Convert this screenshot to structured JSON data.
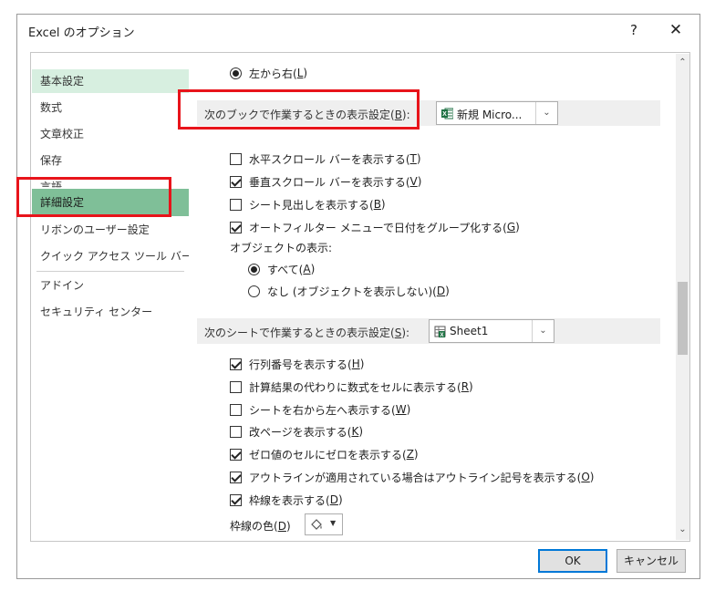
{
  "window": {
    "title": "Excel のオプション",
    "help": "?",
    "close": "✕"
  },
  "nav": {
    "items": [
      {
        "label": "基本設定"
      },
      {
        "label": "数式"
      },
      {
        "label": "文章校正"
      },
      {
        "label": "保存"
      },
      {
        "label": "言語"
      },
      {
        "label": "詳細設定"
      },
      {
        "label": "リボンのユーザー設定"
      },
      {
        "label": "クイック アクセス ツール バー"
      },
      {
        "label": "アドイン"
      },
      {
        "label": "セキュリティ センター"
      }
    ]
  },
  "content": {
    "top_radio": {
      "label": "左から右(",
      "key": "L",
      "end": ")"
    },
    "book_section": {
      "label": "次のブックで作業するときの表示設定(",
      "key": "B",
      "end": "):",
      "dropdown_value": "新規 Micro...",
      "options": [
        {
          "label": "水平スクロール バーを表示する(",
          "key": "T",
          "end": ")",
          "checked": false
        },
        {
          "label": "垂直スクロール バーを表示する(",
          "key": "V",
          "end": ")",
          "checked": true
        },
        {
          "label": "シート見出しを表示する(",
          "key": "B",
          "end": ")",
          "checked": false
        },
        {
          "label": "オートフィルター メニューで日付をグループ化する(",
          "key": "G",
          "end": ")",
          "checked": true
        }
      ],
      "objects_label": "オブジェクトの表示:",
      "objects_radios": [
        {
          "label": "すべて(",
          "key": "A",
          "end": ")",
          "checked": true
        },
        {
          "label": "なし (オブジェクトを表示しない)(",
          "key": "D",
          "end": ")",
          "checked": false
        }
      ]
    },
    "sheet_section": {
      "label": "次のシートで作業するときの表示設定(",
      "key": "S",
      "end": "):",
      "dropdown_value": "Sheet1",
      "options": [
        {
          "label": "行列番号を表示する(",
          "key": "H",
          "end": ")",
          "checked": true
        },
        {
          "label": "計算結果の代わりに数式をセルに表示する(",
          "key": "R",
          "end": ")",
          "checked": false
        },
        {
          "label": "シートを右から左へ表示する(",
          "key": "W",
          "end": ")",
          "checked": false
        },
        {
          "label": "改ページを表示する(",
          "key": "K",
          "end": ")",
          "checked": false
        },
        {
          "label": "ゼロ値のセルにゼロを表示する(",
          "key": "Z",
          "end": ")",
          "checked": true
        },
        {
          "label": "アウトラインが適用されている場合はアウトライン記号を表示する(",
          "key": "O",
          "end": ")",
          "checked": true
        },
        {
          "label": "枠線を表示する(",
          "key": "D",
          "end": ")",
          "checked": true
        }
      ],
      "gridline_color_label": "枠線の色(",
      "gridline_color_key": "D",
      "gridline_color_end": ")"
    }
  },
  "footer": {
    "ok": "OK",
    "cancel": "キャンセル"
  },
  "colors": {
    "accent": "#0078d7",
    "highlight": "#e8141b",
    "nav_selected": "#7fbf98",
    "nav_hover": "#d7efe0",
    "excel_green": "#1f7244"
  }
}
